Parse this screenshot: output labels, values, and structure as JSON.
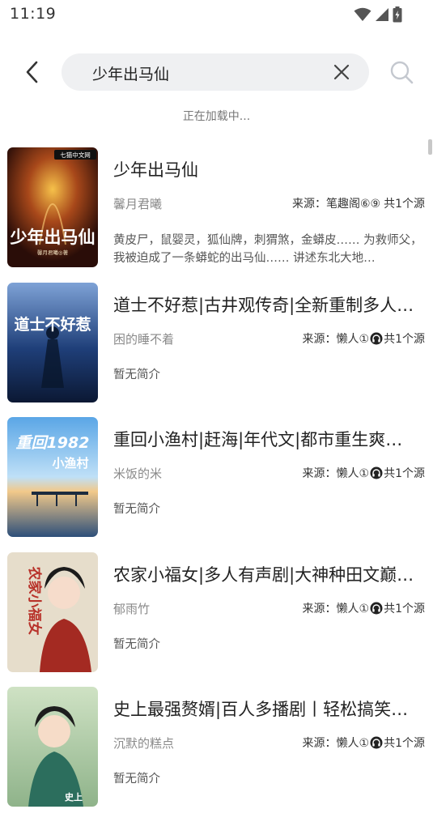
{
  "status_bar": {
    "time": "11:19"
  },
  "search": {
    "query": "少年出马仙"
  },
  "loading": "正在加载中...",
  "results": [
    {
      "title": "少年出马仙",
      "author": "馨月君曦",
      "source_prefix": "来源：",
      "source_name": "笔趣阁⑥⑨",
      "source_count": "共1个源",
      "intro": "黄皮尸，鼠婴灵，狐仙牌，刺猬煞，金蟒皮…… 为救师父，我被迫成了一条蟒蛇的出马仙…… 讲述东北大地…",
      "cover_text": "少年出马仙",
      "cover_badge": "七猫中文网",
      "cover_author": "馨月君曦◎著"
    },
    {
      "title": "道士不好惹|古井观传奇|全新重制多人…",
      "author": "困的睡不着",
      "source_prefix": "来源：",
      "source_name": "懒人①",
      "source_count": "共1个源",
      "intro": "暂无简介",
      "cover_text": "道士不好惹"
    },
    {
      "title": "重回小渔村|赶海|年代文|都市重生爽…",
      "author": "米饭的米",
      "source_prefix": "来源：",
      "source_name": "懒人①",
      "source_count": "共1个源",
      "intro": "暂无简介",
      "cover_text_top": "重回1982",
      "cover_text_bottom": "小渔村"
    },
    {
      "title": "农家小福女|多人有声剧|大神种田文巅…",
      "author": "郁雨竹",
      "source_prefix": "来源：",
      "source_name": "懒人①",
      "source_count": "共1个源",
      "intro": "暂无简介",
      "cover_text": "农家小福女"
    },
    {
      "title": "史上最强赘婿|百人多播剧丨轻松搞笑…",
      "author": "沉默的糕点",
      "source_prefix": "来源：",
      "source_name": "懒人①",
      "source_count": "共1个源",
      "intro": "暂无简介",
      "cover_text": "史上"
    }
  ],
  "icons": {
    "back": "back-arrow-icon",
    "clear": "close-icon",
    "search": "search-icon",
    "source_badge": "headphone-icon"
  }
}
